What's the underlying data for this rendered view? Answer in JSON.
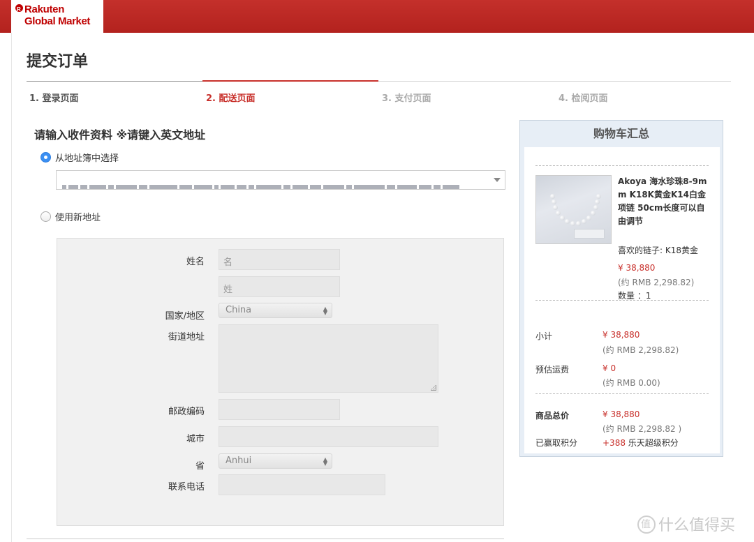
{
  "header": {
    "logo_line1": "Rakuten",
    "logo_line2": "Global Market",
    "brand_color": "#bf0000"
  },
  "page_title": "提交订单",
  "steps": [
    {
      "label": "1. 登录页面"
    },
    {
      "label": "2. 配送页面"
    },
    {
      "label": "3. 支付页面"
    },
    {
      "label": "4. 检阅页面"
    }
  ],
  "section_title": "请输入收件资料 ※请键入英文地址",
  "address_book": {
    "radio_label": "从地址簿中选择"
  },
  "new_address": {
    "radio_label": "使用新地址"
  },
  "form": {
    "name_label": "姓名",
    "first_name_placeholder": "名",
    "last_name_placeholder": "姓",
    "country_label": "国家/地区",
    "country_value": "China",
    "street_label": "街道地址",
    "postal_label": "邮政编码",
    "city_label": "城市",
    "province_label": "省",
    "province_value": "Anhui",
    "phone_label": "联系电话"
  },
  "cart": {
    "title": "购物车汇总",
    "product": {
      "name": "Akoya 海水珍珠8-9mm K18K黄金K14白金项链 50cm长度可以自由调节",
      "option": "喜欢的链子: K18黄金",
      "price": "¥ 38,880",
      "price_rmb": "(约 RMB 2,298.82)",
      "quantity": "数量 ：1"
    },
    "subtotal_label": "小计",
    "subtotal": "¥ 38,880",
    "subtotal_rmb": "(约 RMB 2,298.82)",
    "shipping_label": "预估运费",
    "shipping": "¥ 0",
    "shipping_rmb": "(约 RMB 0.00)",
    "total_label": "商品总价",
    "total": "¥ 38,880",
    "total_rmb": "(约 RMB 2,298.82 )",
    "points_label": "已赢取积分",
    "points_value": "+388",
    "points_text": "乐天超级积分"
  },
  "watermark": "什么值得买"
}
